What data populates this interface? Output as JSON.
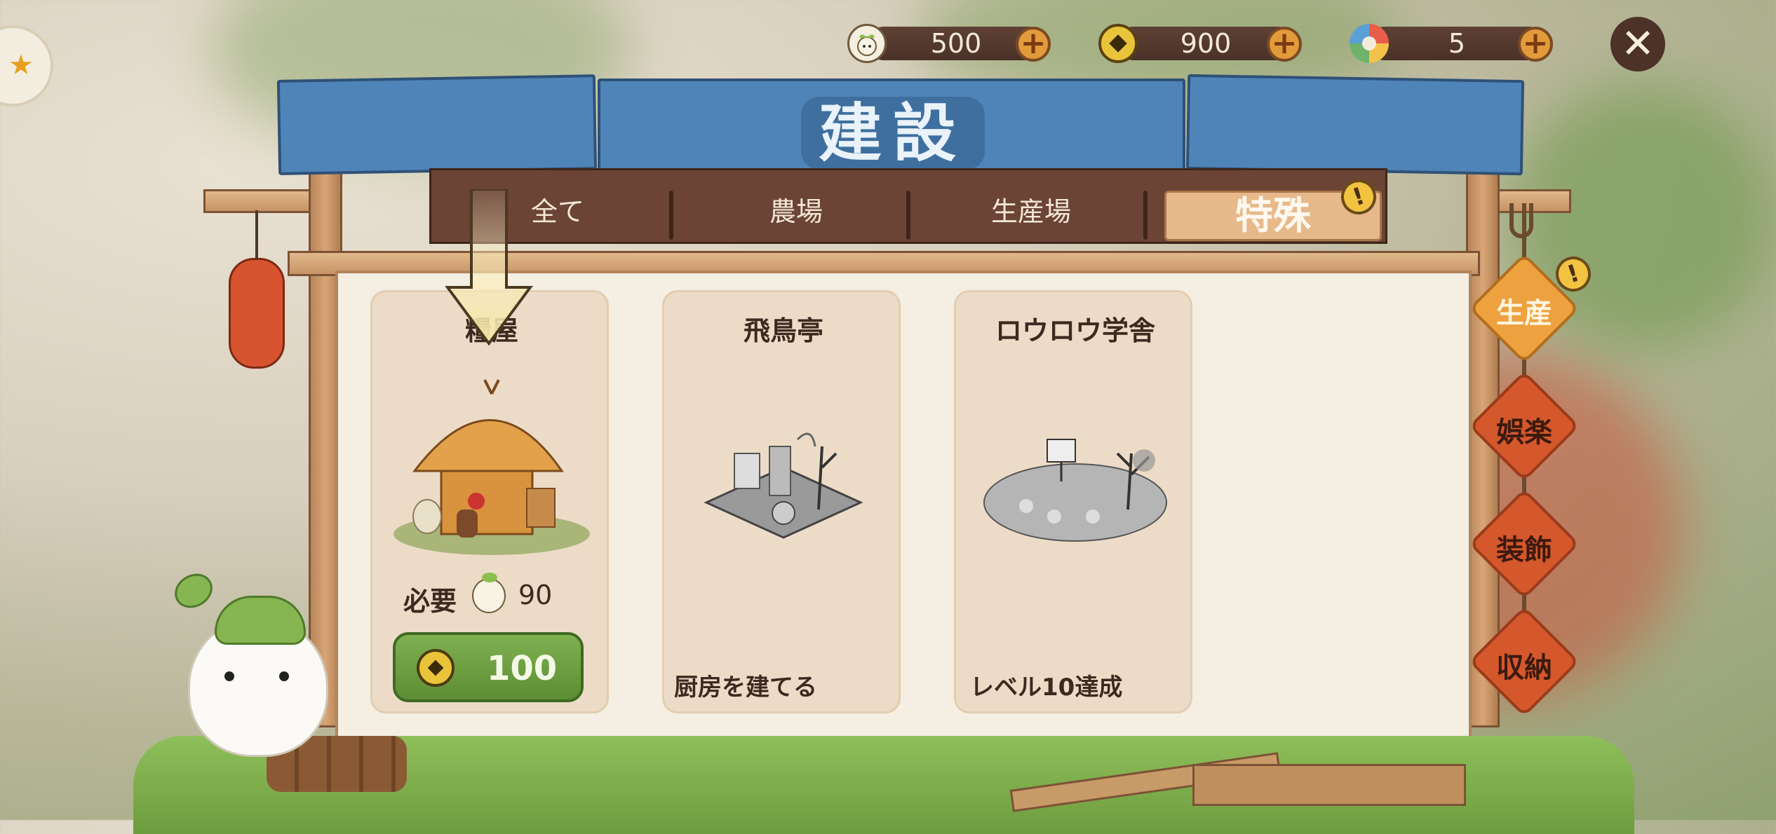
{
  "currencies": [
    {
      "icon": "sprout-seed-icon",
      "value": "500"
    },
    {
      "icon": "coin-icon",
      "value": "900"
    },
    {
      "icon": "donut-ring-icon",
      "value": "5"
    }
  ],
  "close_label": "✕",
  "title": "建設",
  "tabs": [
    {
      "label": "全て"
    },
    {
      "label": "農場"
    },
    {
      "label": "生産場"
    },
    {
      "label": "特殊"
    }
  ],
  "cards": [
    {
      "title": "糧屋",
      "requirement_label": "必要",
      "requirement_value": "90",
      "price": "100"
    },
    {
      "title": "飛鳥亭",
      "note": "厨房を建てる"
    },
    {
      "title": "ロウロウ学舎",
      "note": "レベル10達成"
    }
  ],
  "side_menu": [
    {
      "label": "生産"
    },
    {
      "label": "娯楽"
    },
    {
      "label": "装飾"
    },
    {
      "label": "収納"
    }
  ],
  "badge_symbol": "!",
  "colors": {
    "awning_blue": "#4f84b9",
    "tab_bar_brown": "#6b4436",
    "active_tab": "#e7b98a",
    "build_button_green": "#6d9f42",
    "side_active": "#eea13f",
    "side_inactive": "#d4582c"
  }
}
